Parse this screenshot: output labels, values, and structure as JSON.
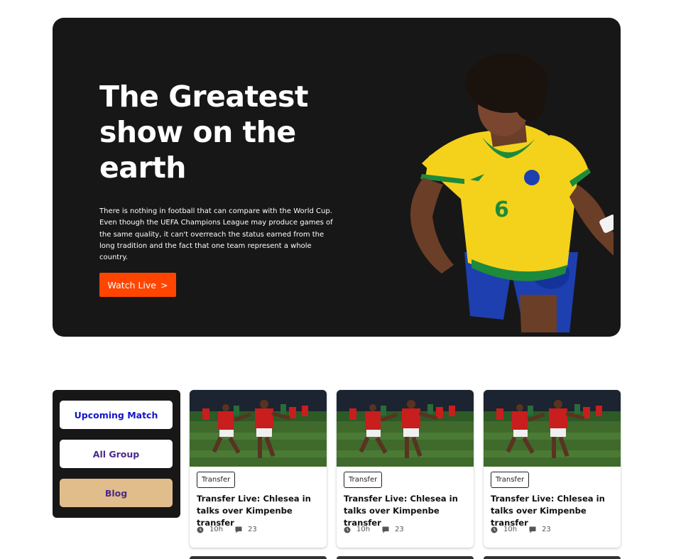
{
  "hero": {
    "title": "The Greatest show on the earth",
    "description": "There is nothing in football that can compare with the World Cup. Even though the UEFA Champions League may produce games of the same quality, it can't overreach the status earned from the long tradition and the fact that one team represent a whole country.",
    "cta_label": "Watch Live",
    "cta_icon": ">",
    "player_image": "football-player-yellow-jersey",
    "jersey_number": "6"
  },
  "sidebar": {
    "items": [
      {
        "label": "Upcoming Match"
      },
      {
        "label": "All Group"
      },
      {
        "label": "Blog"
      }
    ]
  },
  "cards": [
    {
      "tag": "Transfer",
      "title": "Transfer Live: Chlesea in talks over Kimpenbe transfer",
      "time": "10h",
      "comments": "23"
    },
    {
      "tag": "Transfer",
      "title": "Transfer Live: Chlesea in talks over Kimpenbe transfer",
      "time": "10h",
      "comments": "23"
    },
    {
      "tag": "Transfer",
      "title": "Transfer Live: Chlesea in talks over Kimpenbe transfer",
      "time": "10h",
      "comments": "23"
    }
  ],
  "colors": {
    "hero_bg": "#181717",
    "accent": "#ff4500",
    "blog_btn": "#e1bd8c",
    "upcoming_text": "#1414c8",
    "group_text": "#4a2a8a"
  }
}
